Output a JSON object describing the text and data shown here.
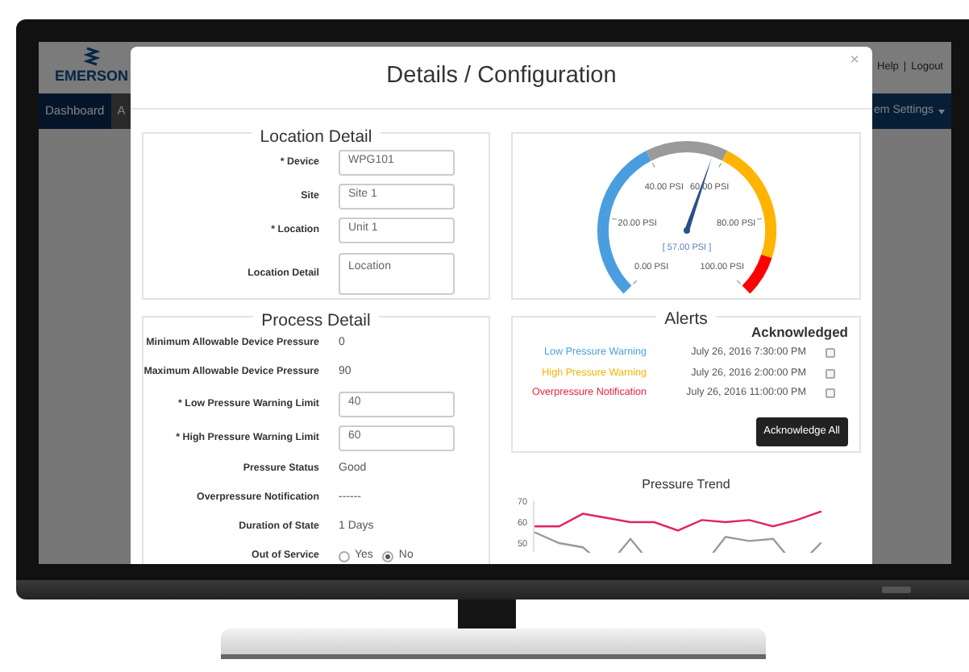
{
  "app": {
    "logo": "EMERSON",
    "header_links": [
      "Help",
      "|",
      "Logout"
    ],
    "nav": [
      {
        "label": "Dashboard",
        "selected": true
      },
      {
        "label": "A",
        "selected": false
      }
    ],
    "nav_right": "em Settings"
  },
  "modal": {
    "title": "Details / Configuration",
    "close": "×",
    "location_detail": {
      "legend": "Location Detail",
      "fields": [
        {
          "kind": "input",
          "label": "* Device",
          "value": "WPG101"
        },
        {
          "kind": "input",
          "label": "Site",
          "value": "Site 1"
        },
        {
          "kind": "input",
          "label": "* Location",
          "value": "Unit 1"
        },
        {
          "kind": "textarea",
          "label": "Location Detail",
          "value": "Location"
        }
      ]
    },
    "process_detail": {
      "legend": "Process Detail",
      "fields": [
        {
          "kind": "text",
          "label": "Minimum Allowable Device Pressure",
          "value": "0"
        },
        {
          "kind": "text",
          "label": "Maximum Allowable Device Pressure",
          "value": "90"
        },
        {
          "kind": "input",
          "label": "* Low Pressure Warning Limit",
          "value": "40"
        },
        {
          "kind": "input",
          "label": "* High Pressure Warning Limit",
          "value": "60"
        },
        {
          "kind": "text",
          "label": "Pressure Status",
          "value": "Good"
        },
        {
          "kind": "text",
          "label": "Overpressure Notification",
          "value": "------"
        },
        {
          "kind": "text",
          "label": "Duration of State",
          "value": "1 Days"
        },
        {
          "kind": "radio",
          "label": "Out of Service",
          "options": [
            {
              "label": "Yes",
              "selected": false
            },
            {
              "label": "No",
              "selected": true
            }
          ]
        }
      ]
    },
    "gauge": {
      "labels": [
        "40.00 PSI",
        "60.00 PSI",
        "20.00 PSI",
        "80.00 PSI",
        "0.00 PSI",
        "100.00 PSI"
      ],
      "readout": "[ 57.00 PSI ]",
      "level": 0.57
    },
    "alerts": {
      "legend": "Alerts",
      "column": "Acknowledged",
      "rows": [
        {
          "name": "Low Pressure Warning",
          "color": "#4aa3df",
          "time": "July 26, 2016 7:30:00 PM",
          "checked": false
        },
        {
          "name": "High Pressure Warning",
          "color": "#f5b400",
          "time": "July 26, 2016 2:00:00 PM",
          "checked": false
        },
        {
          "name": "Overpressure Notification",
          "color": "#e8243c",
          "time": "July 26, 2016 11:00:00 PM",
          "checked": false
        }
      ],
      "button": "Acknowledge All"
    },
    "pressure_trend": {
      "chart_data": {
        "type": "line",
        "title": "Pressure Trend",
        "yticks": [
          50,
          60,
          70
        ],
        "ylim": [
          46,
          70
        ],
        "series": [
          {
            "color": "#e0245e",
            "values": [
              58,
              58,
              64,
              62,
              60,
              60,
              56,
              61,
              60,
              61,
              58,
              61,
              65
            ]
          },
          {
            "color": "#999999",
            "values": [
              55,
              50,
              48,
              null,
              52,
              null,
              null,
              null,
              53,
              51,
              52,
              null,
              50
            ]
          }
        ]
      }
    }
  }
}
